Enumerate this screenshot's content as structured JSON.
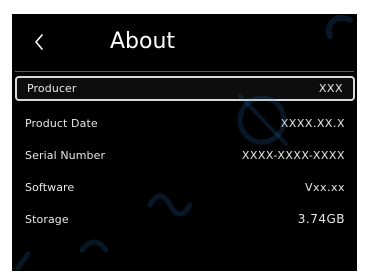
{
  "header": {
    "title": "About",
    "back_icon": "chevron-left-icon"
  },
  "info_rows": [
    {
      "label": "Producer",
      "value": "XXX",
      "selected": true
    },
    {
      "label": "Product Date",
      "value": "XXXX.XX.X",
      "selected": false
    },
    {
      "label": "Serial Number",
      "value": "XXXX-XXXX-XXXX",
      "selected": false
    },
    {
      "label": "Software",
      "value": "Vxx.xx",
      "selected": false
    },
    {
      "label": "Storage",
      "value": "3.74GB",
      "selected": false
    }
  ],
  "colors": {
    "screen_background": "#000000",
    "text": "#ffffff",
    "selection_border": "#d9d9d9",
    "watermark": "#2a7fd4"
  },
  "watermark": {
    "brand_icon": "brand-logo-icon"
  }
}
